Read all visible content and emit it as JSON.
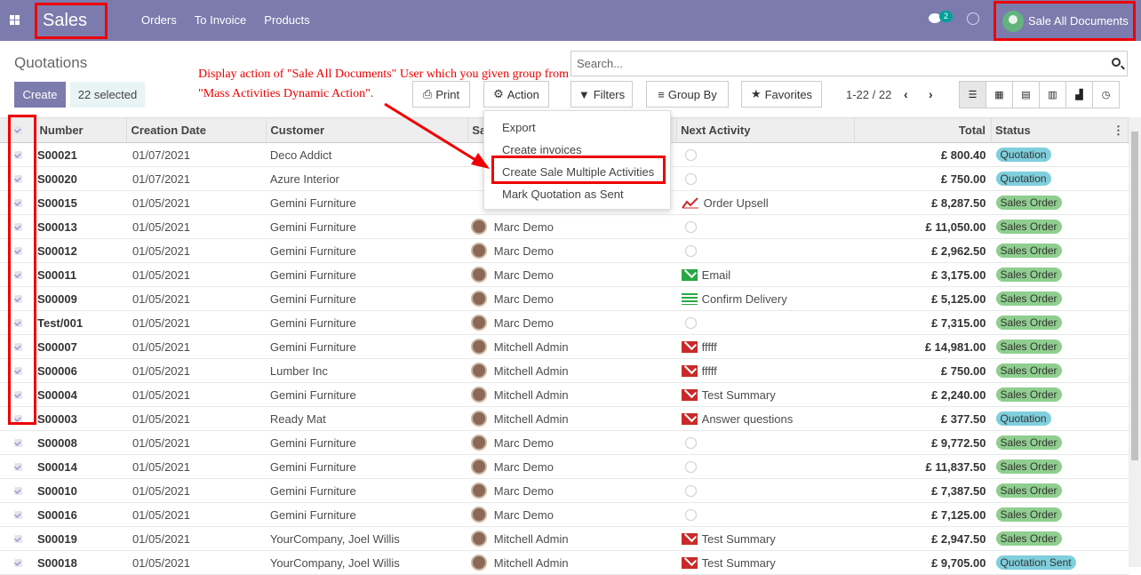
{
  "nav": {
    "brand": "Sales",
    "menu": [
      "Orders",
      "To Invoice",
      "Products"
    ],
    "chat_badge": "2",
    "user": "Sale All Documents"
  },
  "page": {
    "title": "Quotations",
    "create": "Create",
    "selected": "22 selected",
    "annotation_line1": "Display action of \"Sale All Documents\" User which you given group from",
    "annotation_line2": "\"Mass Activities Dynamic Action\"."
  },
  "search": {
    "placeholder": "Search..."
  },
  "toolbar": {
    "print": "Print",
    "action": "Action",
    "filters": "Filters",
    "groupby": "Group By",
    "favorites": "Favorites",
    "pager": "1-22 / 22"
  },
  "action_menu": [
    "Export",
    "Create invoices",
    "Create Sale Multiple Activities",
    "Mark Quotation as Sent"
  ],
  "columns": [
    "Number",
    "Creation Date",
    "Customer",
    "Sa",
    "Next Activity",
    "Total",
    "Status"
  ],
  "rows": [
    {
      "number": "S00021",
      "date": "01/07/2021",
      "customer": "Deco Addict",
      "salesperson": "",
      "activity": "",
      "activity_icon": "clock",
      "total": "£ 800.40",
      "status": "Quotation",
      "status_type": "q"
    },
    {
      "number": "S00020",
      "date": "01/07/2021",
      "customer": "Azure Interior",
      "salesperson": "",
      "activity": "",
      "activity_icon": "clock",
      "total": "£ 750.00",
      "status": "Quotation",
      "status_type": "q"
    },
    {
      "number": "S00015",
      "date": "01/05/2021",
      "customer": "Gemini Furniture",
      "salesperson": "",
      "activity": "Order Upsell",
      "activity_icon": "upsell",
      "total": "£ 8,287.50",
      "status": "Sales Order",
      "status_type": "s"
    },
    {
      "number": "S00013",
      "date": "01/05/2021",
      "customer": "Gemini Furniture",
      "salesperson": "Marc Demo",
      "activity": "",
      "activity_icon": "clock",
      "total": "£ 11,050.00",
      "status": "Sales Order",
      "status_type": "s"
    },
    {
      "number": "S00012",
      "date": "01/05/2021",
      "customer": "Gemini Furniture",
      "salesperson": "Marc Demo",
      "activity": "",
      "activity_icon": "clock",
      "total": "£ 2,962.50",
      "status": "Sales Order",
      "status_type": "s"
    },
    {
      "number": "S00011",
      "date": "01/05/2021",
      "customer": "Gemini Furniture",
      "salesperson": "Marc Demo",
      "activity": "Email",
      "activity_icon": "mail-green",
      "total": "£ 3,175.00",
      "status": "Sales Order",
      "status_type": "s"
    },
    {
      "number": "S00009",
      "date": "01/05/2021",
      "customer": "Gemini Furniture",
      "salesperson": "Marc Demo",
      "activity": "Confirm Delivery",
      "activity_icon": "delivery",
      "total": "£ 5,125.00",
      "status": "Sales Order",
      "status_type": "s"
    },
    {
      "number": "Test/001",
      "date": "01/05/2021",
      "customer": "Gemini Furniture",
      "salesperson": "Marc Demo",
      "activity": "",
      "activity_icon": "clock",
      "total": "£ 7,315.00",
      "status": "Sales Order",
      "status_type": "s"
    },
    {
      "number": "S00007",
      "date": "01/05/2021",
      "customer": "Gemini Furniture",
      "salesperson": "Mitchell Admin",
      "activity": "fffff",
      "activity_icon": "mail-red",
      "total": "£ 14,981.00",
      "status": "Sales Order",
      "status_type": "s"
    },
    {
      "number": "S00006",
      "date": "01/05/2021",
      "customer": "Lumber Inc",
      "salesperson": "Mitchell Admin",
      "activity": "fffff",
      "activity_icon": "mail-red",
      "total": "£ 750.00",
      "status": "Sales Order",
      "status_type": "s"
    },
    {
      "number": "S00004",
      "date": "01/05/2021",
      "customer": "Gemini Furniture",
      "salesperson": "Mitchell Admin",
      "activity": "Test Summary",
      "activity_icon": "mail-red",
      "total": "£ 2,240.00",
      "status": "Sales Order",
      "status_type": "s"
    },
    {
      "number": "S00003",
      "date": "01/05/2021",
      "customer": "Ready Mat",
      "salesperson": "Mitchell Admin",
      "activity": "Answer questions",
      "activity_icon": "mail-red",
      "total": "£ 377.50",
      "status": "Quotation",
      "status_type": "q"
    },
    {
      "number": "S00008",
      "date": "01/05/2021",
      "customer": "Gemini Furniture",
      "salesperson": "Marc Demo",
      "activity": "",
      "activity_icon": "clock",
      "total": "£ 9,772.50",
      "status": "Sales Order",
      "status_type": "s"
    },
    {
      "number": "S00014",
      "date": "01/05/2021",
      "customer": "Gemini Furniture",
      "salesperson": "Marc Demo",
      "activity": "",
      "activity_icon": "clock",
      "total": "£ 11,837.50",
      "status": "Sales Order",
      "status_type": "s"
    },
    {
      "number": "S00010",
      "date": "01/05/2021",
      "customer": "Gemini Furniture",
      "salesperson": "Marc Demo",
      "activity": "",
      "activity_icon": "clock",
      "total": "£ 7,387.50",
      "status": "Sales Order",
      "status_type": "s"
    },
    {
      "number": "S00016",
      "date": "01/05/2021",
      "customer": "Gemini Furniture",
      "salesperson": "Marc Demo",
      "activity": "",
      "activity_icon": "clock",
      "total": "£ 7,125.00",
      "status": "Sales Order",
      "status_type": "s"
    },
    {
      "number": "S00019",
      "date": "01/05/2021",
      "customer": "YourCompany, Joel Willis",
      "salesperson": "Mitchell Admin",
      "activity": "Test Summary",
      "activity_icon": "mail-red",
      "total": "£ 2,947.50",
      "status": "Sales Order",
      "status_type": "s"
    },
    {
      "number": "S00018",
      "date": "01/05/2021",
      "customer": "YourCompany, Joel Willis",
      "salesperson": "Mitchell Admin",
      "activity": "Test Summary",
      "activity_icon": "mail-red",
      "total": "£ 9,705.00",
      "status": "Quotation Sent",
      "status_type": "q"
    }
  ],
  "colors": {
    "navbar": "#7c7bad",
    "highlight": "#ee0000",
    "badge_quotation": "#7fcfdc",
    "badge_sales": "#8fce8f"
  }
}
